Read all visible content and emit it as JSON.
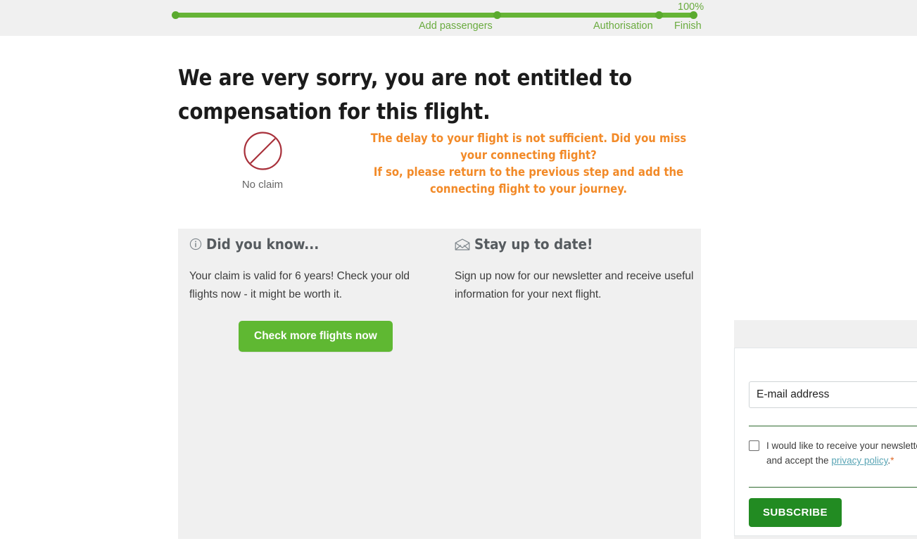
{
  "progress": {
    "percent_label": "100%",
    "steps": [
      {
        "label": "",
        "name": "start"
      },
      {
        "label": "Add passengers",
        "name": "add-passengers"
      },
      {
        "label": "Authorisation",
        "name": "authorisation"
      },
      {
        "label": "Finish",
        "name": "finish"
      }
    ],
    "accent_color": "#66b436"
  },
  "headline": "We are very sorry, you are not entitled to compensation for this flight.",
  "result": {
    "icon_name": "no-claim-icon",
    "icon_color": "#a8303a",
    "label": "No claim",
    "warning_color": "#f28a28",
    "warning_lines": [
      "The delay to your flight is not sufficient. Did you miss",
      "your connecting flight?",
      "If so, please return to the previous step and add the",
      "connecting flight to your journey."
    ]
  },
  "did_you_know": {
    "icon_name": "info-circle-icon",
    "title": "Did you know...",
    "body": "Your claim is valid for 6 years! Check your old flights now - it might be worth it.",
    "cta_label": "Check more flights now",
    "cta_color": "#5fb832"
  },
  "newsletter": {
    "icon_name": "envelope-icon",
    "title": "Stay up to date!",
    "body": "Sign up now for our newsletter and receive useful information for your next flight.",
    "email_placeholder": "E-mail address",
    "email_value": "",
    "consent_prefix": "I would like to receive your newsletter and accept the ",
    "consent_link": "privacy policy",
    "consent_suffix": ".",
    "required_marker": "*",
    "checkbox_checked": false,
    "submit_label": "SUBSCRIBE",
    "submit_color": "#228b22"
  }
}
